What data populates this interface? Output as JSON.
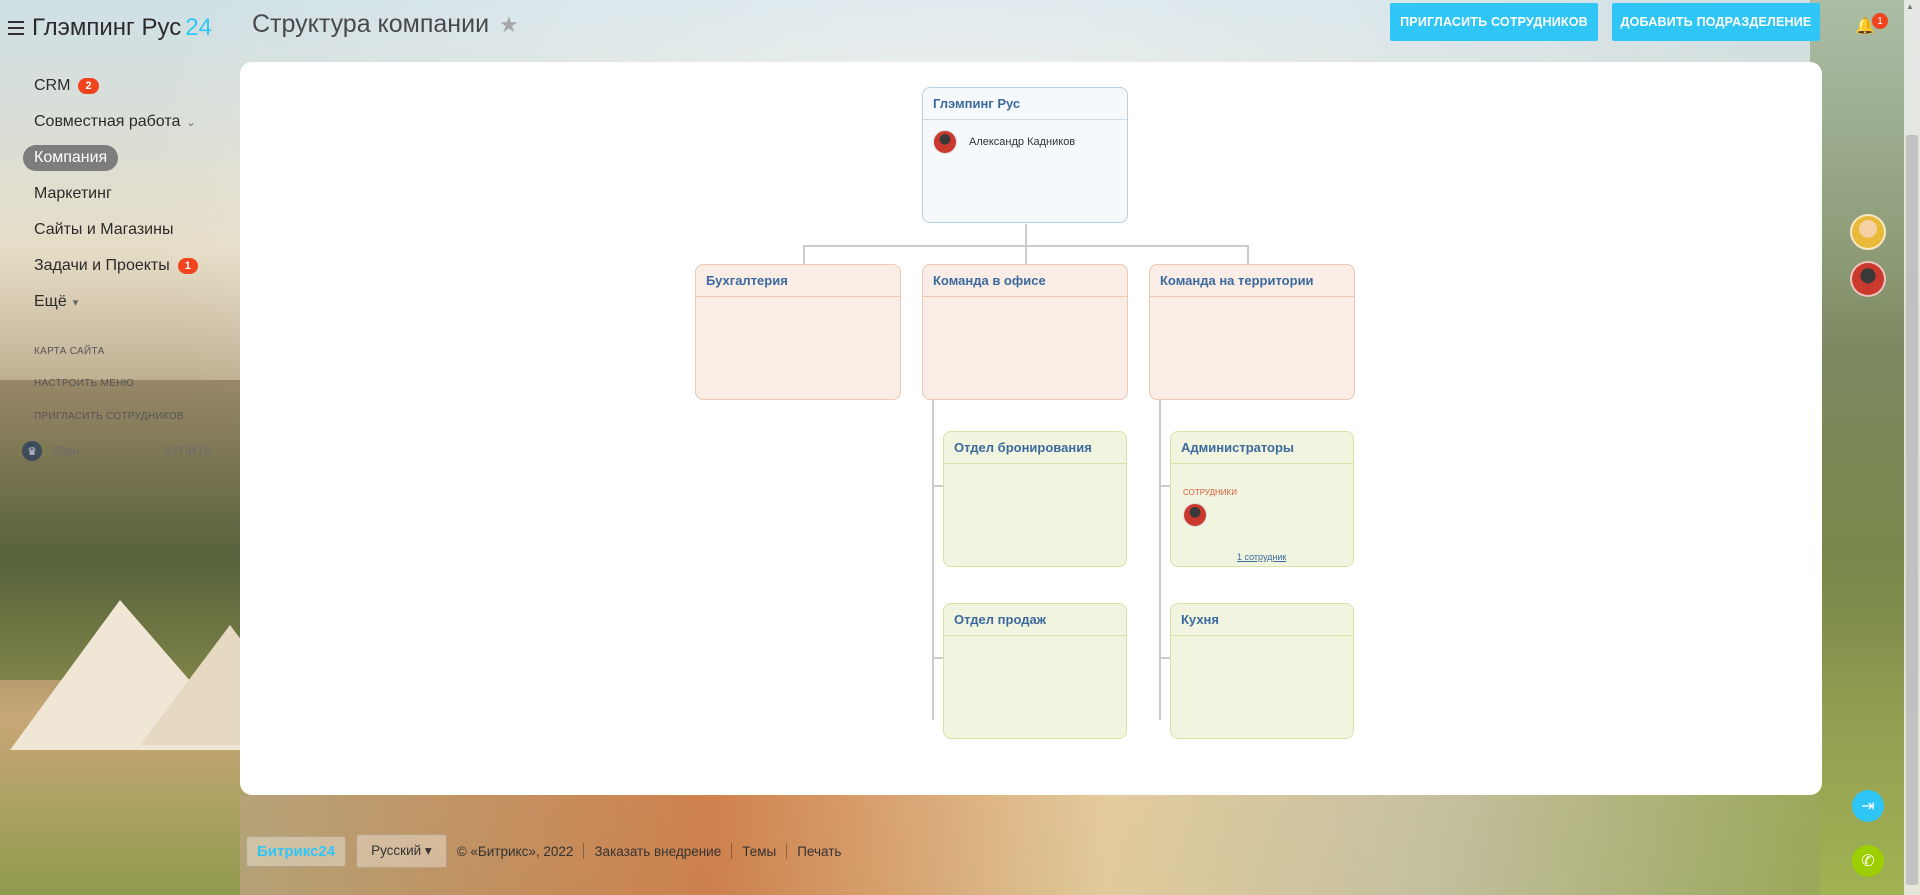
{
  "app": {
    "brand_name": "Глэмпинг Рус",
    "brand_suffix": "24"
  },
  "page": {
    "title": "Структура компании"
  },
  "header": {
    "invite_button": "ПРИГЛАСИТЬ СОТРУДНИКОВ",
    "add_department_button": "ДОБАВИТЬ ПОДРАЗДЕЛЕНИЕ",
    "notification_count": "1"
  },
  "sidebar": {
    "items": [
      {
        "label": "CRM",
        "badge": "2"
      },
      {
        "label": "Совместная работа",
        "chevron": "⌄"
      },
      {
        "label": "Компания",
        "active": true
      },
      {
        "label": "Маркетинг"
      },
      {
        "label": "Сайты и Магазины"
      },
      {
        "label": "Задачи и Проекты",
        "badge": "1"
      },
      {
        "label": "Ещё",
        "chevron": "▾"
      }
    ],
    "links": {
      "sitemap": "КАРТА САЙТА",
      "customize_menu": "НАСТРОИТЬ МЕНЮ",
      "invite": "ПРИГЛАСИТЬ СОТРУДНИКОВ"
    },
    "trial": {
      "left": "30дн",
      "buy": "КУПИТЬ"
    }
  },
  "org": {
    "root": {
      "name": "Глэмпинг Рус",
      "head": "Александр Кадников"
    },
    "level1": [
      {
        "name": "Бухгалтерия"
      },
      {
        "name": "Команда в офисе"
      },
      {
        "name": "Команда на территории"
      }
    ],
    "office_children": [
      {
        "name": "Отдел бронирования"
      },
      {
        "name": "Отдел продаж"
      }
    ],
    "territory_children": [
      {
        "name": "Администраторы",
        "employees_label": "СОТРУДНИКИ",
        "employees_link": "1 сотрудник"
      },
      {
        "name": "Кухня"
      }
    ]
  },
  "footer": {
    "logo": "Битрикс24",
    "language": "Русский",
    "copyright": "© «Битрикс», 2022",
    "links": [
      "Заказать внедрение",
      "Темы",
      "Печать"
    ]
  },
  "colors": {
    "accent": "#2fc6f6",
    "badge": "#f0431e",
    "title_link": "#3d6a9e"
  }
}
